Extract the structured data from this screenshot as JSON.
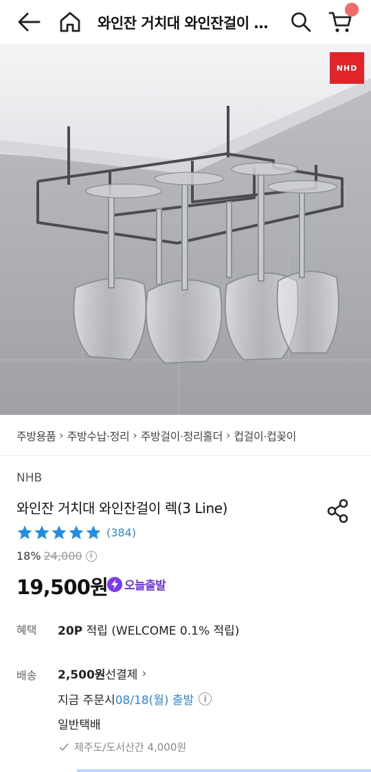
{
  "header": {
    "title": "와인잔 거치대 와인잔걸이 렉(3 Line)",
    "icons": [
      "back-arrow-icon",
      "home-icon",
      "search-icon",
      "cart-icon"
    ]
  },
  "hero": {
    "brand_logo": "NHD"
  },
  "breadcrumb": [
    "주방용품",
    "주방수납·정리",
    "주방걸이·정리홀더",
    "컵걸이·컵꽂이"
  ],
  "product": {
    "brand": "NHB",
    "title": "와인잔 거치대 와인잔걸이 렉(3 Line)",
    "rating_stars": 5,
    "review_count": "(384)",
    "discount": "18%",
    "original_price": "24,000",
    "price": "19,500원",
    "badge": "오늘출발"
  },
  "benefit": {
    "label": "혜택",
    "points": "20P",
    "text": " 적립 (WELCOME 0.1% 적립)"
  },
  "shipping": {
    "label": "배송",
    "fee": "2,500원",
    "fee_suffix": " 선결제",
    "order_prefix": "지금 주문시 ",
    "date": "08/18(월) 출발",
    "method": "일반택배",
    "note": "제주도/도서산간 4,000원"
  },
  "colors": {
    "accent_blue": "#2a8be0",
    "badge_purple": "#6f35e8",
    "cart_dot": "#f26b6b",
    "logo_red": "#e0242a"
  }
}
